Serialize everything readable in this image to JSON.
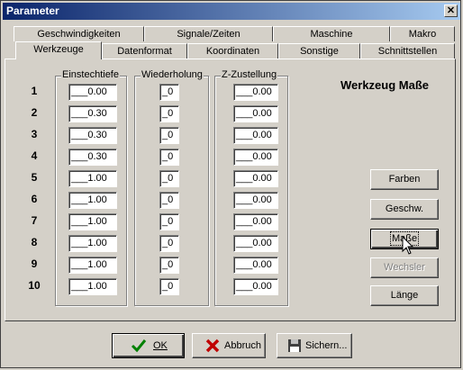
{
  "window": {
    "title": "Parameter",
    "close_glyph": "✕"
  },
  "tabs_back": [
    {
      "label": "Geschwindigkeiten"
    },
    {
      "label": "Signale/Zeiten"
    },
    {
      "label": "Maschine"
    },
    {
      "label": "Makro"
    }
  ],
  "tabs_front": [
    {
      "label": "Werkzeuge"
    },
    {
      "label": "Datenformat"
    },
    {
      "label": "Koordinaten"
    },
    {
      "label": "Sonstige"
    },
    {
      "label": "Schnittstellen"
    }
  ],
  "groups": {
    "einstechtiefe": "Einstechtiefe",
    "wiederholung": "Wiederholung",
    "zustellung": "Z-Zustellung"
  },
  "rows": [
    {
      "num": "1",
      "einstechtiefe": "___0.00",
      "wiederholung": "_0",
      "zustellung": "___0.00"
    },
    {
      "num": "2",
      "einstechtiefe": "___0.30",
      "wiederholung": "_0",
      "zustellung": "___0.00"
    },
    {
      "num": "3",
      "einstechtiefe": "___0.30",
      "wiederholung": "_0",
      "zustellung": "___0.00"
    },
    {
      "num": "4",
      "einstechtiefe": "___0.30",
      "wiederholung": "_0",
      "zustellung": "___0.00"
    },
    {
      "num": "5",
      "einstechtiefe": "___1.00",
      "wiederholung": "_0",
      "zustellung": "___0.00"
    },
    {
      "num": "6",
      "einstechtiefe": "___1.00",
      "wiederholung": "_0",
      "zustellung": "___0.00"
    },
    {
      "num": "7",
      "einstechtiefe": "___1.00",
      "wiederholung": "_0",
      "zustellung": "___0.00"
    },
    {
      "num": "8",
      "einstechtiefe": "___1.00",
      "wiederholung": "_0",
      "zustellung": "___0.00"
    },
    {
      "num": "9",
      "einstechtiefe": "___1.00",
      "wiederholung": "_0",
      "zustellung": "___0.00"
    },
    {
      "num": "10",
      "einstechtiefe": "___1.00",
      "wiederholung": "_0",
      "zustellung": "___0.00"
    }
  ],
  "side": {
    "heading": "Werkzeug Maße",
    "farben": "Farben",
    "geschw": "Geschw.",
    "masse": "Maße",
    "wechsler": "Wechsler",
    "laenge": "Länge"
  },
  "bottom": {
    "ok": "OK",
    "abbruch": "Abbruch",
    "sichern": "Sichern..."
  },
  "colors": {
    "ok_check": "#008000",
    "cancel_x": "#c00000",
    "titlebar": "#0a246a"
  }
}
